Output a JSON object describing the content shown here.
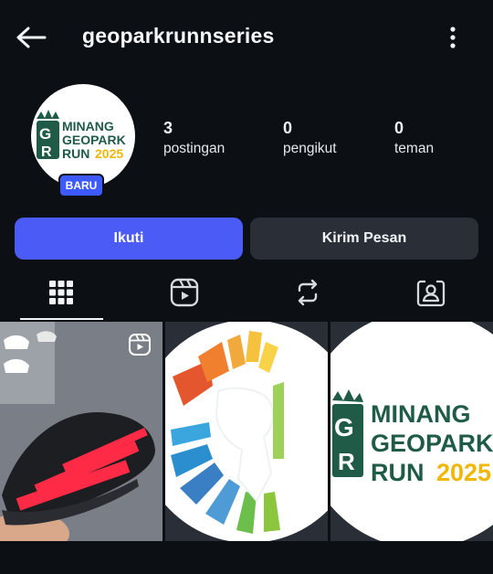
{
  "header": {
    "username": "geoparkrunnseries",
    "back_icon": "arrow-left-icon",
    "more_icon": "more-vertical-icon"
  },
  "profile": {
    "avatar_text": [
      "MINANG",
      "GEOPARK",
      "RUN"
    ],
    "avatar_year": "2025",
    "badge": "BARU"
  },
  "stats": {
    "posts": {
      "value": "3",
      "label": "postingan"
    },
    "followers": {
      "value": "0",
      "label": "pengikut"
    },
    "friends": {
      "value": "0",
      "label": "teman"
    }
  },
  "actions": {
    "follow_label": "Ikuti",
    "message_label": "Kirim Pesan"
  },
  "tabs": [
    {
      "name": "posts",
      "icon": "grid-icon",
      "active": true
    },
    {
      "name": "reels",
      "icon": "reels-icon",
      "active": false
    },
    {
      "name": "reposts",
      "icon": "repost-icon",
      "active": false
    },
    {
      "name": "tagged",
      "icon": "tagged-person-icon",
      "active": false
    }
  ],
  "posts": [
    {
      "kind": "reel",
      "subject": "running shoe",
      "icon": "reel-icon"
    },
    {
      "kind": "image",
      "subject": "colorful logo"
    },
    {
      "kind": "image",
      "subject": "event logo",
      "text": [
        "MINANG",
        "GEOPARK",
        "RUN"
      ],
      "year": "2025"
    }
  ],
  "colors": {
    "background": "#0c0f14",
    "accent": "#4a5cf5",
    "badge": "#3d5afe",
    "secondary_button": "#2a2f37",
    "logo_green": "#1f5b46",
    "logo_yellow": "#f2b705"
  }
}
